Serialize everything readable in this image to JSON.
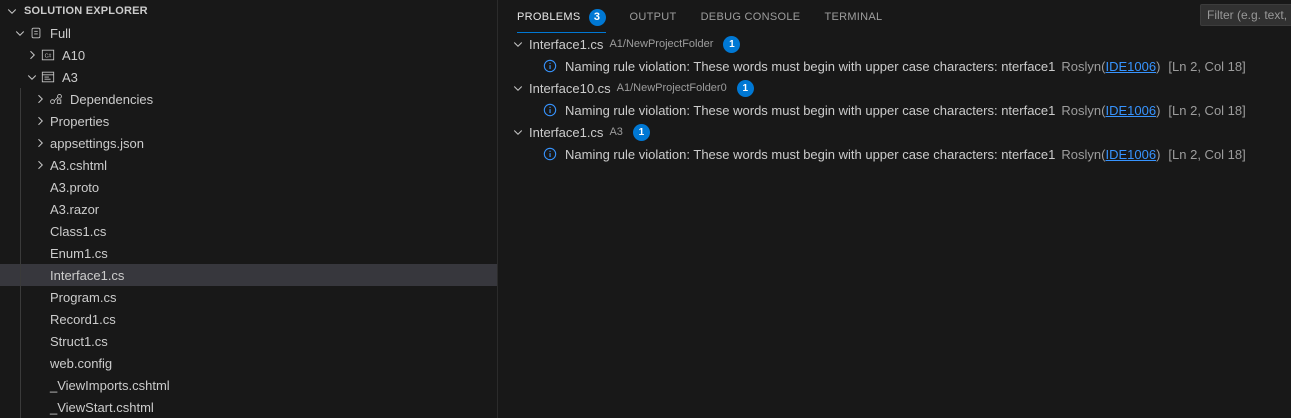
{
  "explorer": {
    "title": "SOLUTION EXPLORER",
    "items": [
      {
        "label": "Full",
        "depth": 0,
        "chevron": "down",
        "icon": "solution-icon"
      },
      {
        "label": "A10",
        "depth": 1,
        "chevron": "right",
        "icon": "csharp-project-icon"
      },
      {
        "label": "A3",
        "depth": 1,
        "chevron": "down",
        "icon": "web-project-icon"
      },
      {
        "label": "Dependencies",
        "depth": 2,
        "chevron": "right",
        "icon": "dependencies-icon"
      },
      {
        "label": "Properties",
        "depth": 2,
        "chevron": "right",
        "icon": ""
      },
      {
        "label": "appsettings.json",
        "depth": 2,
        "chevron": "right",
        "icon": ""
      },
      {
        "label": "A3.cshtml",
        "depth": 2,
        "chevron": "right",
        "icon": ""
      },
      {
        "label": "A3.proto",
        "depth": 2,
        "chevron": "",
        "icon": ""
      },
      {
        "label": "A3.razor",
        "depth": 2,
        "chevron": "",
        "icon": ""
      },
      {
        "label": "Class1.cs",
        "depth": 2,
        "chevron": "",
        "icon": ""
      },
      {
        "label": "Enum1.cs",
        "depth": 2,
        "chevron": "",
        "icon": ""
      },
      {
        "label": "Interface1.cs",
        "depth": 2,
        "chevron": "",
        "icon": "",
        "selected": true
      },
      {
        "label": "Program.cs",
        "depth": 2,
        "chevron": "",
        "icon": ""
      },
      {
        "label": "Record1.cs",
        "depth": 2,
        "chevron": "",
        "icon": ""
      },
      {
        "label": "Struct1.cs",
        "depth": 2,
        "chevron": "",
        "icon": ""
      },
      {
        "label": "web.config",
        "depth": 2,
        "chevron": "",
        "icon": ""
      },
      {
        "label": "_ViewImports.cshtml",
        "depth": 2,
        "chevron": "",
        "icon": ""
      },
      {
        "label": "_ViewStart.cshtml",
        "depth": 2,
        "chevron": "",
        "icon": ""
      }
    ]
  },
  "panel": {
    "tabs": [
      {
        "label": "PROBLEMS",
        "count": "3",
        "active": true
      },
      {
        "label": "OUTPUT"
      },
      {
        "label": "DEBUG CONSOLE"
      },
      {
        "label": "TERMINAL"
      }
    ],
    "filter_placeholder": "Filter (e.g. text,",
    "problems": [
      {
        "file": "Interface1.cs",
        "path": "A1/NewProjectFolder",
        "count": "1",
        "message": "Naming rule violation: These words must begin with upper case characters: nterface1",
        "source": "Roslyn(",
        "code": "IDE1006",
        "source_end": ")",
        "location": "[Ln 2, Col 18]"
      },
      {
        "file": "Interface10.cs",
        "path": "A1/NewProjectFolder0",
        "count": "1",
        "message": "Naming rule violation: These words must begin with upper case characters: nterface1",
        "source": "Roslyn(",
        "code": "IDE1006",
        "source_end": ")",
        "location": "[Ln 2, Col 18]"
      },
      {
        "file": "Interface1.cs",
        "path": "A3",
        "count": "1",
        "message": "Naming rule violation: These words must begin with upper case characters: nterface1",
        "source": "Roslyn(",
        "code": "IDE1006",
        "source_end": ")",
        "location": "[Ln 2, Col 18]"
      }
    ]
  },
  "colors": {
    "background": "#181818",
    "selection": "#37373d",
    "accent": "#0078d4",
    "link": "#3794ff"
  }
}
